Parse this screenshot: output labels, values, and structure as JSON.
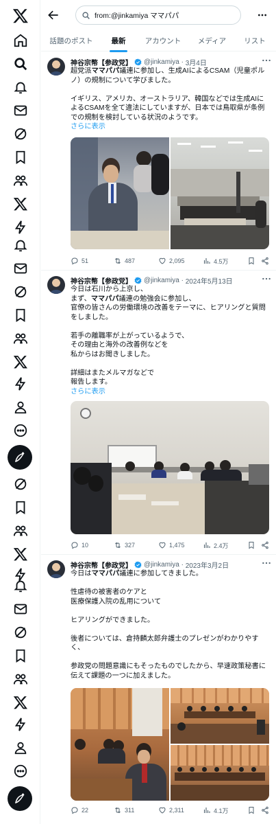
{
  "search": {
    "query": "from:@jinkamiya ママパパ"
  },
  "tabs": [
    {
      "label": "話題のポスト"
    },
    {
      "label": "最新"
    },
    {
      "label": "アカウント"
    },
    {
      "label": "メディア"
    },
    {
      "label": "リスト"
    }
  ],
  "posts": [
    {
      "name": "神谷宗幣【参政党】",
      "handle": "@jinkamiya",
      "date": "3月4日",
      "text_a": "超党派",
      "text_b": "ママパパ",
      "text_c": "議連に参加し、生成AIによるCSAM（児童ポルノ）の規制について学びました。\n\nイギリス、アメリカ、オーストラリア、韓国などでは生成AIによるCSAMを全て違法にしていますが、日本では鳥取県が条例での規制を検討している状況のようです。",
      "show_more": "さらに表示",
      "replies": "51",
      "reposts": "487",
      "likes": "2,095",
      "views": "4.5万"
    },
    {
      "name": "神谷宗幣【参政党】",
      "handle": "@jinkamiya",
      "date": "2024年5月13日",
      "text_a": "今日は石川から上京し、\nまず、",
      "text_b": "ママパパ",
      "text_c": "議連の勉強会に参加し、\n官僚の皆さんの労働環境の改善をテーマに、ヒアリングと質問をしました。\n\n若手の離職率が上がっているようで、\nその理由と海外の改善例などを\n私からはお聞きしました。\n\n詳細はまたメルマガなどで\n報告します。",
      "show_more": "さらに表示",
      "replies": "10",
      "reposts": "327",
      "likes": "1,475",
      "views": "2.4万"
    },
    {
      "name": "神谷宗幣【参政党】",
      "handle": "@jinkamiya",
      "date": "2023年3月2日",
      "text_a": "今日は",
      "text_b": "ママパパ",
      "text_c": "議連に参加してきました。\n\n性虐待の被害者のケアと\n医療保護入院の乱用について\n\nヒアリングができました。\n\n後者については、倉持麟太郎弁護士のプレゼンがわかりやすく、\n\n参政党の問題意識にもそったものでしたから、早速政策秘書に伝えて課題の一つに加えました。",
      "show_more": "",
      "replies": "22",
      "reposts": "311",
      "likes": "2,311",
      "views": "4.1万"
    }
  ],
  "colors": {
    "accent": "#1d9bf0",
    "text": "#0f1419",
    "muted": "#536471"
  }
}
